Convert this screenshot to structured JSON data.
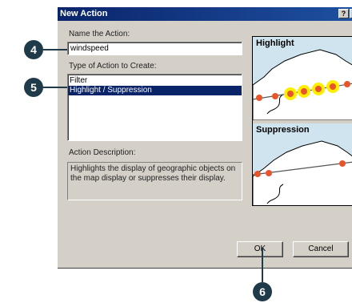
{
  "dialog": {
    "title": "New Action",
    "help_btn": "?",
    "name_label": "Name  the Action:",
    "name_value": "windspeed",
    "type_label": "Type of Action to Create:",
    "type_options": [
      "Filter",
      "Highlight / Suppression"
    ],
    "selected_index": 1,
    "description_label": "Action Description:",
    "description_text": "Highlights the display of geographic objects on the map display or suppresses their display.",
    "preview": {
      "top_title": "Highlight",
      "bottom_title": "Suppression"
    },
    "ok_label": "OK",
    "cancel_label": "Cancel"
  },
  "callouts": [
    "4",
    "5",
    "6"
  ],
  "colors": {
    "titlebar": "#0a246a",
    "selection": "#0a246a",
    "highlight_halo": "#ffee00",
    "marker": "#e8552a",
    "map_water": "#cfe4ef",
    "callout": "#1f3a48"
  }
}
